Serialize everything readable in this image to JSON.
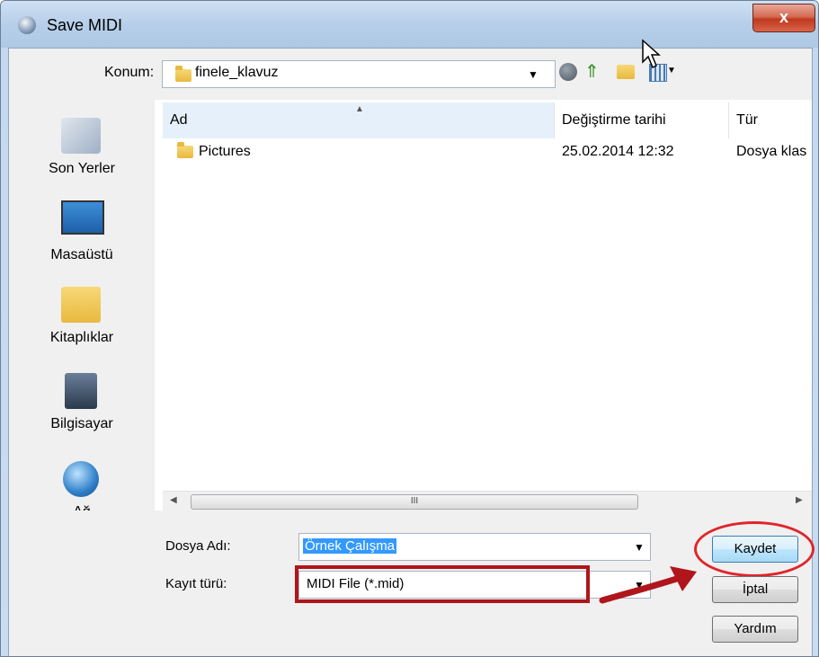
{
  "window": {
    "title": "Save MIDI",
    "close_label": "x"
  },
  "location": {
    "label": "Konum:",
    "current_folder": "finele_klavuz"
  },
  "places": [
    {
      "label": "Son Yerler",
      "icon": "recent-places-icon"
    },
    {
      "label": "Masaüstü",
      "icon": "desktop-icon"
    },
    {
      "label": "Kitaplıklar",
      "icon": "libraries-icon"
    },
    {
      "label": "Bilgisayar",
      "icon": "computer-icon"
    },
    {
      "label": "Ağ",
      "icon": "network-icon"
    }
  ],
  "columns": [
    "Ad",
    "Değiştirme tarihi",
    "Tür"
  ],
  "files": [
    {
      "name": "Pictures",
      "modified": "25.02.2014 12:32",
      "type": "Dosya klas"
    }
  ],
  "scrollbar": {
    "thumb_grip": "III"
  },
  "filename": {
    "label": "Dosya Adı:",
    "value": "Örnek Çalışma"
  },
  "filetype": {
    "label": "Kayıt türü:",
    "value": "MIDI File (*.mid)"
  },
  "buttons": {
    "save": "Kaydet",
    "cancel": "İptal",
    "help": "Yardım"
  },
  "annotation_color": "#b0151c"
}
